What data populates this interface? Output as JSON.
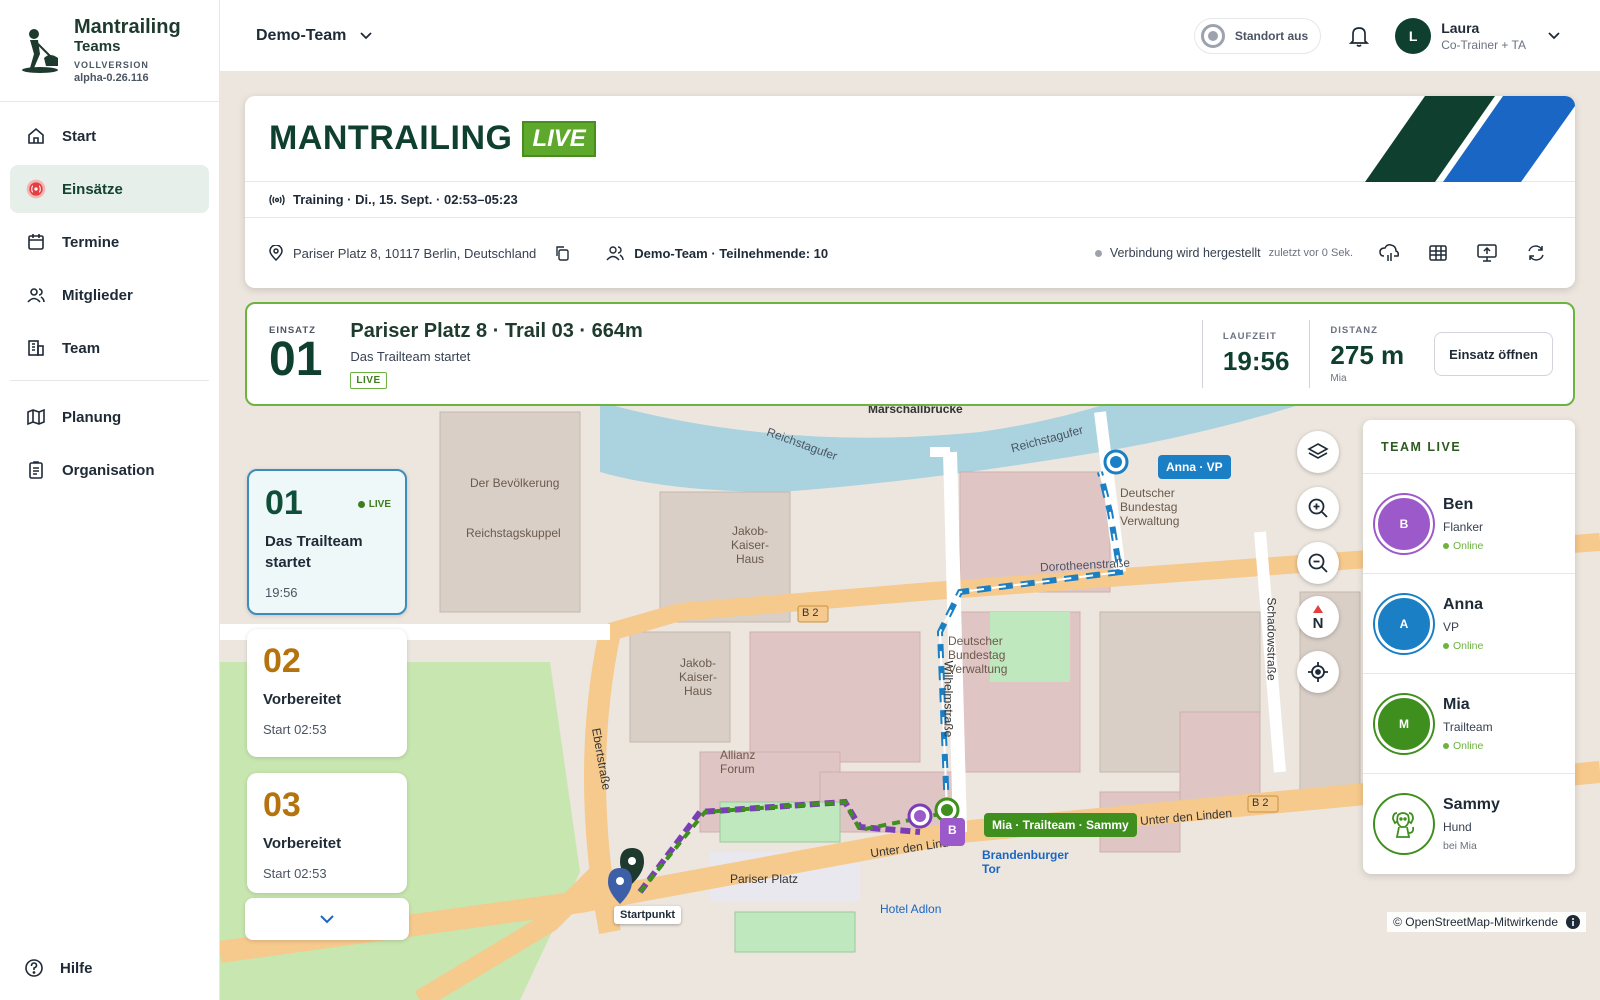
{
  "brand": {
    "name1": "Mantrailing",
    "name2": "Teams",
    "edition": "VOLLVERSION",
    "version": "alpha-0.26.116"
  },
  "sidebar": {
    "items": [
      {
        "label": "Start",
        "icon": "home-icon"
      },
      {
        "label": "Einsätze",
        "icon": "broadcast-icon",
        "active": true
      },
      {
        "label": "Termine",
        "icon": "calendar-icon"
      },
      {
        "label": "Mitglieder",
        "icon": "users-icon"
      },
      {
        "label": "Team",
        "icon": "building-icon"
      }
    ],
    "items2": [
      {
        "label": "Planung",
        "icon": "map-icon"
      },
      {
        "label": "Organisation",
        "icon": "clipboard-icon"
      }
    ],
    "help": "Hilfe"
  },
  "topbar": {
    "team": "Demo-Team",
    "location_button": "Standort aus",
    "user": {
      "initial": "L",
      "name": "Laura",
      "role": "Co-Trainer + TA"
    }
  },
  "header": {
    "title": "MANTRAILING",
    "live_badge": "LIVE",
    "session": "Training · Di., 15. Sept. · 02:53–05:23",
    "address": "Pariser Platz 8, 10117 Berlin, Deutschland",
    "team_info": "Demo-Team · Teilnehmende: 10",
    "connection": "Verbindung wird hergestellt",
    "connection_ago": "zuletzt vor 0 Sek.",
    "colors": {
      "dark": "#0f3f2f",
      "blue": "#1a66c4",
      "live": "#5ea82b"
    }
  },
  "einsatz": {
    "label": "EINSATZ",
    "number": "01",
    "title": "Pariser Platz 8 · Trail 03 · 664m",
    "subtitle": "Das Trailteam startet",
    "badge": "LIVE",
    "laufzeit_label": "LAUFZEIT",
    "laufzeit": "19:56",
    "distanz_label": "DISTANZ",
    "distanz": "275 m",
    "distanz_sub": "Mia",
    "open_button": "Einsatz öffnen"
  },
  "einsatz_list": [
    {
      "num": "01",
      "status": "LIVE",
      "title": "Das Trailteam startet",
      "meta": "19:56"
    },
    {
      "num": "02",
      "title": "Vorbereitet",
      "meta": "Start 02:53"
    },
    {
      "num": "03",
      "title": "Vorbereitet",
      "meta": "Start 02:53"
    }
  ],
  "team_live": {
    "heading": "TEAM LIVE",
    "members": [
      {
        "initial": "B",
        "name": "Ben",
        "role": "Flanker",
        "status": "Online",
        "color": "#9b59c9"
      },
      {
        "initial": "A",
        "name": "Anna",
        "role": "VP",
        "status": "Online",
        "color": "#1a7fc4"
      },
      {
        "initial": "M",
        "name": "Mia",
        "role": "Trailteam",
        "status": "Online",
        "color": "#3f8f1e"
      },
      {
        "initial": "",
        "name": "Sammy",
        "role": "Hund",
        "status": "bei Mia",
        "color": "#ffffff"
      }
    ]
  },
  "map": {
    "labels": {
      "marschall": "Marschallbrücke",
      "reichstagufer": "Reichstagufer",
      "dorotheen": "Dorotheenstraße",
      "unter_linden": "Unter den Linden",
      "pariser_platz": "Pariser Platz",
      "wilhelm": "Wilhelmstraße",
      "ebert": "Ebertstraße",
      "brandenburger": "Brandenburger Tor",
      "hotel": "Hotel Adlon",
      "reichstagskuppel": "Reichstagskuppel",
      "bevoelkerung": "Der Bevölkerung",
      "jakob": "Jakob-Kaiser-Haus",
      "allianz": "Allianz Forum",
      "schadow": "Schadowstraße",
      "bundestag": "Deutscher Bundestag Verwaltung",
      "b2": "B 2"
    },
    "pill_anna": "Anna · VP",
    "pill_mia": "Mia · Trailteam · Sammy",
    "pill_b": "B",
    "start": "Startpunkt",
    "attribution": "© OpenStreetMap-Mitwirkende"
  }
}
